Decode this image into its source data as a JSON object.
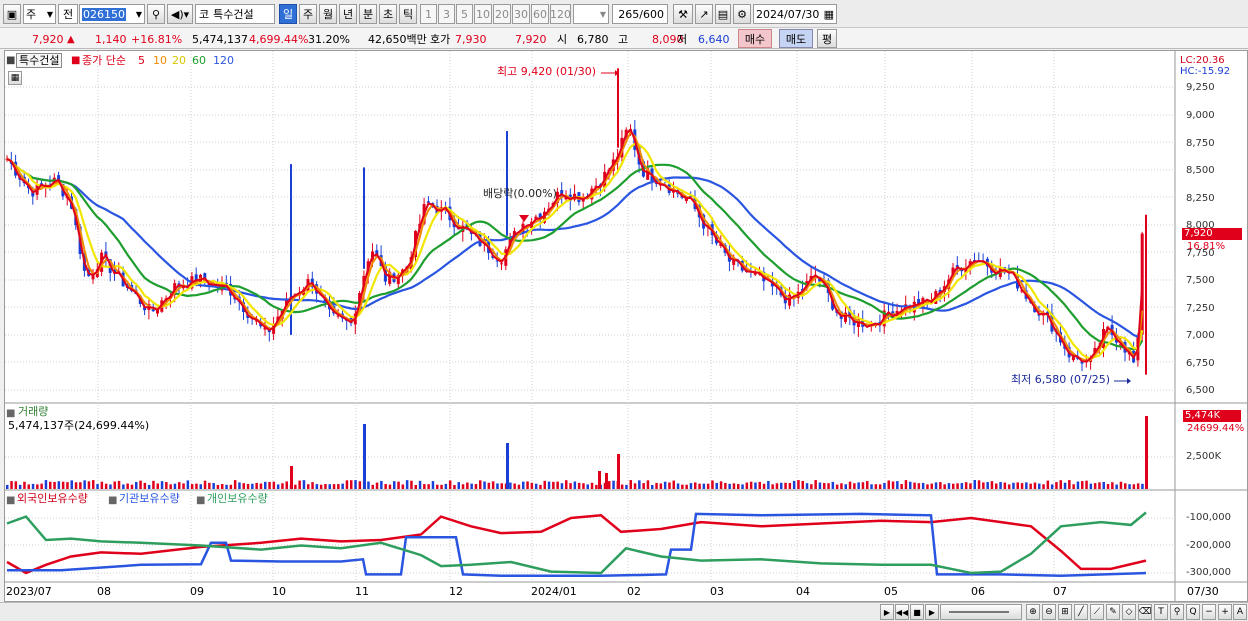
{
  "toolbar": {
    "market": "주",
    "prev": "전",
    "code": "026150",
    "name_prefix": "코",
    "stock_name": "특수건설",
    "periods": [
      "일",
      "주",
      "월",
      "년",
      "분",
      "초",
      "틱"
    ],
    "active_period": "일",
    "minute_options": [
      "1",
      "3",
      "5",
      "10",
      "20",
      "30",
      "60",
      "120"
    ],
    "count": "265",
    "count_total": "/600",
    "date": "2024/07/30"
  },
  "quote": {
    "price": "7,920",
    "change": "1,140",
    "change_pct": "+16.81%",
    "volume": "5,474,137",
    "volume_ratio": "4,699.44%",
    "turnover": "31.20%",
    "amount": "42,650백만",
    "bid_label": "호가",
    "bid": "7,930",
    "ask": "7,920",
    "open_label": "시",
    "open": "6,780",
    "high_label": "고",
    "high": "8,090",
    "low_label": "저",
    "low": "6,640",
    "buy_label": "매수",
    "sell_label": "매도",
    "eval_label": "평"
  },
  "legend": {
    "name": "특수건설",
    "ma_label": "종가 단순",
    "ma_periods": [
      "5",
      "10",
      "20",
      "60",
      "120"
    ]
  },
  "annotations": {
    "high": "최고 9,420 (01/30)",
    "low": "최저 6,580 (07/25)",
    "dividend": "배당락(0.00%)",
    "lc": "LC:20.36",
    "hc": "HC:-15.92",
    "price_tag": "7,920",
    "pct_tag": "16.81%"
  },
  "volume_panel": {
    "title": "거래량",
    "info": "5,474,137주(24,699.44%)",
    "tag1": "5,474K",
    "tag2": "24699.44%"
  },
  "holding_panel": {
    "series": [
      "외국인보유수량",
      "기관보유수량",
      "개인보유수량"
    ]
  },
  "price_axis": [
    "9,250",
    "9,000",
    "8,750",
    "8,500",
    "8,250",
    "8,000",
    "7,750",
    "7,500",
    "7,250",
    "7,000",
    "6,750",
    "6,500"
  ],
  "volume_axis": [
    "2,500K"
  ],
  "holding_axis": [
    "-100,000",
    "-200,000",
    "-300,000"
  ],
  "date_axis": [
    "2023/07",
    "08",
    "09",
    "10",
    "11",
    "12",
    "2024/01",
    "02",
    "03",
    "04",
    "05",
    "06",
    "07"
  ],
  "date_axis_right": "07/30",
  "colors": {
    "up": "#e0001b",
    "down": "#1a3fd6",
    "ma5": "#e0001b",
    "ma10": "#f08a00",
    "ma20": "#f2e600",
    "ma60": "#1e9e2e",
    "ma120": "#2a55e0",
    "foreign": "#e0001b",
    "institution": "#2a55e0",
    "individual": "#2e9e5e"
  }
}
